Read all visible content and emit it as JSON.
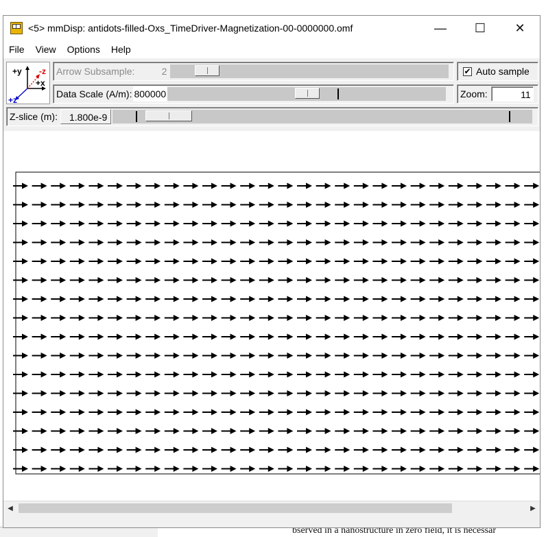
{
  "window": {
    "title": "<5> mmDisp: antidots-filled-Oxs_TimeDriver-Magnetization-00-0000000.omf",
    "minimize_glyph": "—",
    "maximize_glyph": "☐",
    "close_glyph": "✕"
  },
  "menu": {
    "file": "File",
    "view": "View",
    "options": "Options",
    "help": "Help"
  },
  "axes": {
    "y_label": "+y",
    "z_label_top": "-z",
    "x_label": "+x",
    "z_label_bottom": "+z"
  },
  "controls": {
    "arrow_subsample_label": "Arrow Subsample:",
    "arrow_subsample_value": "2",
    "arrow_subsample_enabled": false,
    "auto_sample_label": "Auto sample",
    "auto_sample_checked": true,
    "data_scale_label": "Data Scale (A/m):",
    "data_scale_value": "800000",
    "zoom_label": "Zoom:",
    "zoom_value": "11",
    "zslice_label": "Z-slice (m):",
    "zslice_value": "1.800e-9"
  },
  "vector_field": {
    "rows": 16,
    "columns": 28,
    "direction": "+x",
    "arrow_color": "#000000"
  },
  "background_doc": {
    "bottom_text": "bserved in a nanostructure in zero field, it is necessar"
  }
}
